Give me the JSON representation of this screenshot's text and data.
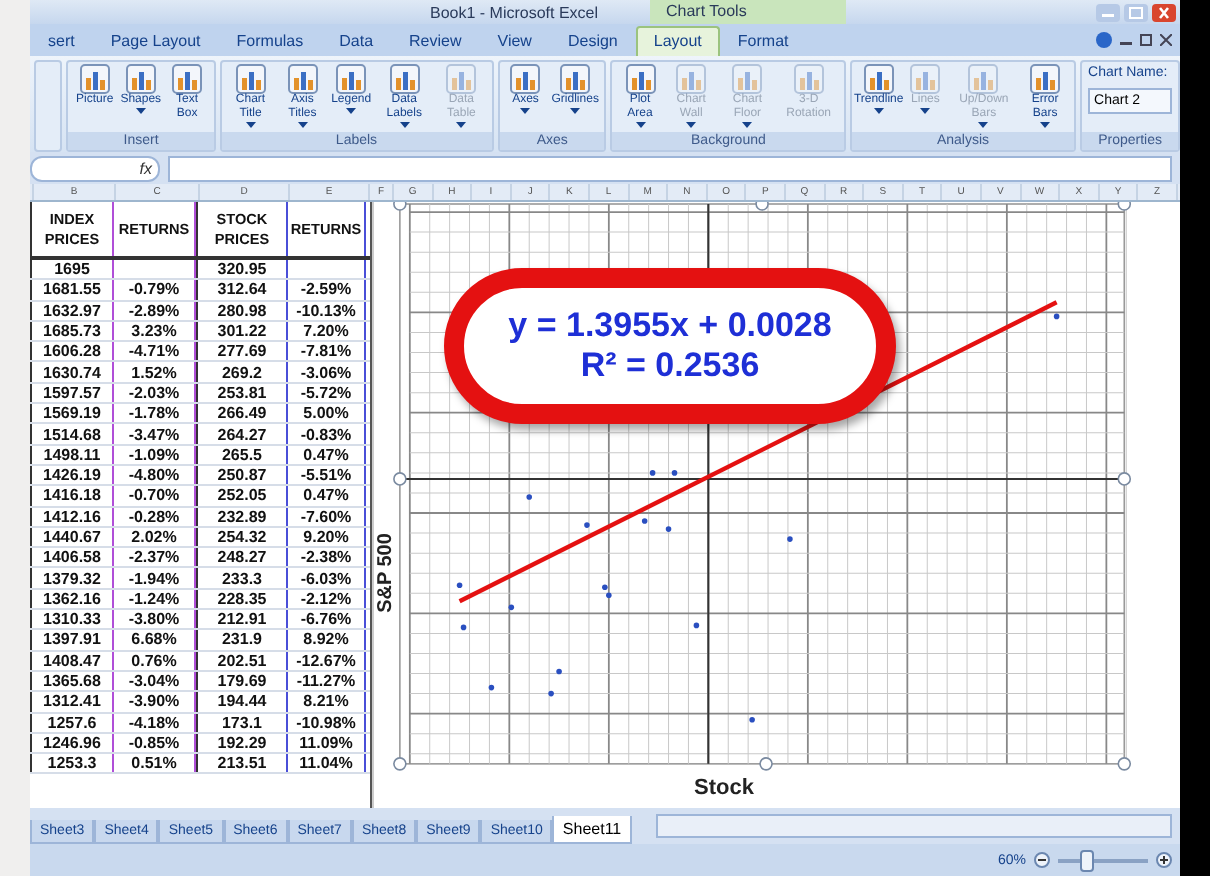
{
  "window": {
    "title": "Book1 - Microsoft Excel",
    "context_title": "Chart Tools"
  },
  "tabs": [
    {
      "label": "sert",
      "selected": false
    },
    {
      "label": "Page Layout",
      "selected": false
    },
    {
      "label": "Formulas",
      "selected": false
    },
    {
      "label": "Data",
      "selected": false
    },
    {
      "label": "Review",
      "selected": false
    },
    {
      "label": "View",
      "selected": false
    },
    {
      "label": "Design",
      "selected": false
    },
    {
      "label": "Layout",
      "selected": true
    },
    {
      "label": "Format",
      "selected": false
    }
  ],
  "ribbon": [
    {
      "name": "Insert",
      "kind": "buttons",
      "buttons": [
        {
          "label": "Picture",
          "disabled": false,
          "menu": false
        },
        {
          "label": "Shapes",
          "disabled": false,
          "menu": true
        },
        {
          "label": "Text Box",
          "disabled": false,
          "menu": false
        }
      ]
    },
    {
      "name": "Labels",
      "kind": "buttons",
      "buttons": [
        {
          "label": "Chart Title",
          "disabled": false,
          "menu": true
        },
        {
          "label": "Axis Titles",
          "disabled": false,
          "menu": true
        },
        {
          "label": "Legend",
          "disabled": false,
          "menu": true
        },
        {
          "label": "Data Labels",
          "disabled": false,
          "menu": true
        },
        {
          "label": "Data Table",
          "disabled": true,
          "menu": true
        }
      ]
    },
    {
      "name": "Axes",
      "kind": "buttons",
      "buttons": [
        {
          "label": "Axes",
          "disabled": false,
          "menu": true
        },
        {
          "label": "Gridlines",
          "disabled": false,
          "menu": true
        }
      ]
    },
    {
      "name": "Background",
      "kind": "buttons",
      "buttons": [
        {
          "label": "Plot Area",
          "disabled": false,
          "menu": true
        },
        {
          "label": "Chart Wall",
          "disabled": true,
          "menu": true
        },
        {
          "label": "Chart Floor",
          "disabled": true,
          "menu": true
        },
        {
          "label": "3-D Rotation",
          "disabled": true,
          "menu": false
        }
      ]
    },
    {
      "name": "Analysis",
      "kind": "buttons",
      "buttons": [
        {
          "label": "Trendline",
          "disabled": false,
          "menu": true
        },
        {
          "label": "Lines",
          "disabled": true,
          "menu": true
        },
        {
          "label": "Up/Down Bars",
          "disabled": true,
          "menu": true
        },
        {
          "label": "Error Bars",
          "disabled": false,
          "menu": true
        }
      ]
    },
    {
      "name": "Properties",
      "kind": "properties",
      "field_label": "Chart Name:",
      "field_value": "Chart 2"
    }
  ],
  "formula_bar": {
    "function_label": "fx"
  },
  "column_headers": [
    "B",
    "C",
    "D",
    "E",
    "F",
    "G",
    "H",
    "I",
    "J",
    "K",
    "L",
    "M",
    "N",
    "O",
    "P",
    "Q",
    "R",
    "S",
    "T",
    "U",
    "V",
    "W",
    "X",
    "Y",
    "Z"
  ],
  "table": {
    "columns": [
      "INDEX PRICES",
      "RETURNS",
      "STOCK PRICES",
      "RETURNS"
    ],
    "rows": [
      [
        "1695",
        "",
        "320.95",
        ""
      ],
      [
        "1681.55",
        "-0.79%",
        "312.64",
        "-2.59%"
      ],
      [
        "1632.97",
        "-2.89%",
        "280.98",
        "-10.13%"
      ],
      [
        "1685.73",
        "3.23%",
        "301.22",
        "7.20%"
      ],
      [
        "1606.28",
        "-4.71%",
        "277.69",
        "-7.81%"
      ],
      [
        "1630.74",
        "1.52%",
        "269.2",
        "-3.06%"
      ],
      [
        "1597.57",
        "-2.03%",
        "253.81",
        "-5.72%"
      ],
      [
        "1569.19",
        "-1.78%",
        "266.49",
        "5.00%"
      ],
      [
        "1514.68",
        "-3.47%",
        "264.27",
        "-0.83%"
      ],
      [
        "1498.11",
        "-1.09%",
        "265.5",
        "0.47%"
      ],
      [
        "1426.19",
        "-4.80%",
        "250.87",
        "-5.51%"
      ],
      [
        "1416.18",
        "-0.70%",
        "252.05",
        "0.47%"
      ],
      [
        "1412.16",
        "-0.28%",
        "232.89",
        "-7.60%"
      ],
      [
        "1440.67",
        "2.02%",
        "254.32",
        "9.20%"
      ],
      [
        "1406.58",
        "-2.37%",
        "248.27",
        "-2.38%"
      ],
      [
        "1379.32",
        "-1.94%",
        "233.3",
        "-6.03%"
      ],
      [
        "1362.16",
        "-1.24%",
        "228.35",
        "-2.12%"
      ],
      [
        "1310.33",
        "-3.80%",
        "212.91",
        "-6.76%"
      ],
      [
        "1397.91",
        "6.68%",
        "231.9",
        "8.92%"
      ],
      [
        "1408.47",
        "0.76%",
        "202.51",
        "-12.67%"
      ],
      [
        "1365.68",
        "-3.04%",
        "179.69",
        "-11.27%"
      ],
      [
        "1312.41",
        "-3.90%",
        "194.44",
        "8.21%"
      ],
      [
        "1257.6",
        "-4.18%",
        "173.1",
        "-10.98%"
      ],
      [
        "1246.96",
        "-0.85%",
        "192.29",
        "11.09%"
      ],
      [
        "1253.3",
        "0.51%",
        "213.51",
        "11.04%"
      ]
    ]
  },
  "chart": {
    "equation": "y = 1.3955x + 0.0028",
    "r_squared": "R² = 0.2536",
    "ylabel": "S&P 500",
    "xlabel": "Stock"
  },
  "sheets": [
    {
      "label": "Sheet3",
      "selected": false
    },
    {
      "label": "Sheet4",
      "selected": false
    },
    {
      "label": "Sheet5",
      "selected": false
    },
    {
      "label": "Sheet6",
      "selected": false
    },
    {
      "label": "Sheet7",
      "selected": false
    },
    {
      "label": "Sheet8",
      "selected": false
    },
    {
      "label": "Sheet9",
      "selected": false
    },
    {
      "label": "Sheet10",
      "selected": false
    },
    {
      "label": "Sheet11",
      "selected": true
    }
  ],
  "status_bar": {
    "zoom": "60%",
    "level": 0.3
  }
}
